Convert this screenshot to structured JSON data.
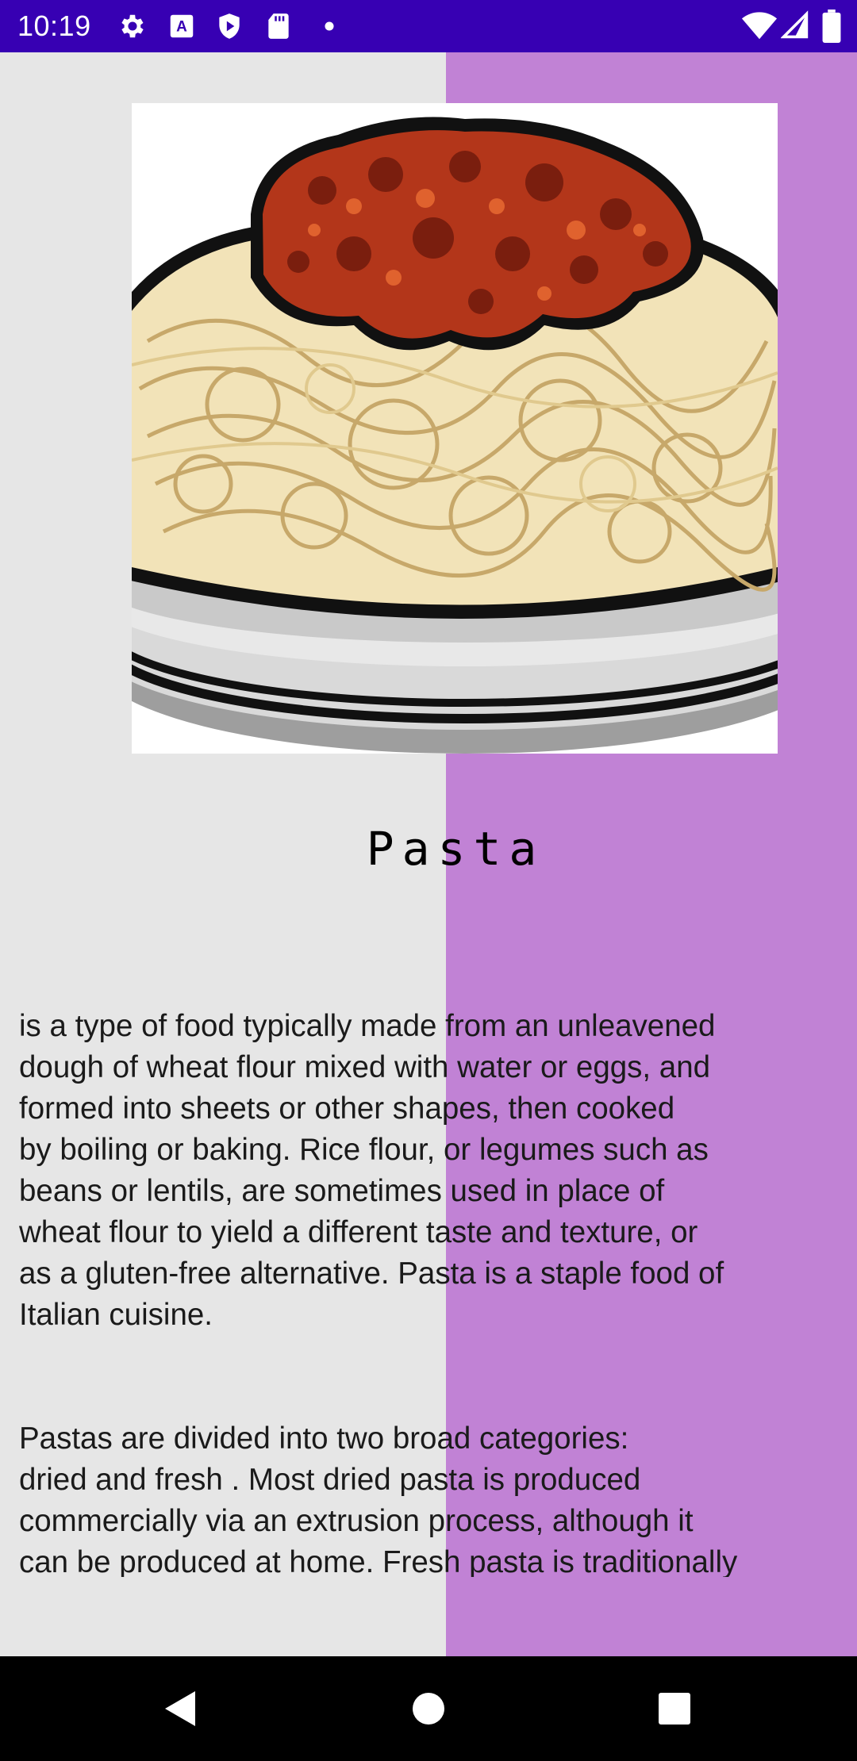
{
  "status_bar": {
    "time": "10:19",
    "left_icons": [
      "settings-icon",
      "font-a-icon",
      "shield-icon",
      "sd-card-icon",
      "dot-icon"
    ],
    "right_icons": [
      "wifi-icon",
      "signal-icon",
      "battery-icon"
    ],
    "background": "#3700b3"
  },
  "colors": {
    "left_panel": "#e6e6e6",
    "right_panel": "#c182d5"
  },
  "article": {
    "image_alt": "spaghetti-bolognese",
    "title": "Pasta",
    "paragraphs": [
      "is a type of food typically made from an unleavened\ndough of wheat flour mixed with water or eggs, and\nformed into sheets or other shapes, then cooked\nby boiling or baking. Rice flour, or legumes such as\nbeans or lentils, are sometimes used in place of\nwheat flour to yield a different taste and texture, or\nas a gluten-free alternative. Pasta is a staple food of\nItalian cuisine.",
      "Pastas are divided into two broad categories:\ndried and fresh . Most dried pasta is produced\ncommercially via an extrusion process, although it\ncan be produced at home. Fresh pasta is traditionally\nproduced by hand, sometimes with the aid of simple\nmachines. Fresh pastas available in grocery stores"
    ]
  },
  "nav_bar": {
    "buttons": [
      "back-icon",
      "home-icon",
      "recents-icon"
    ]
  }
}
